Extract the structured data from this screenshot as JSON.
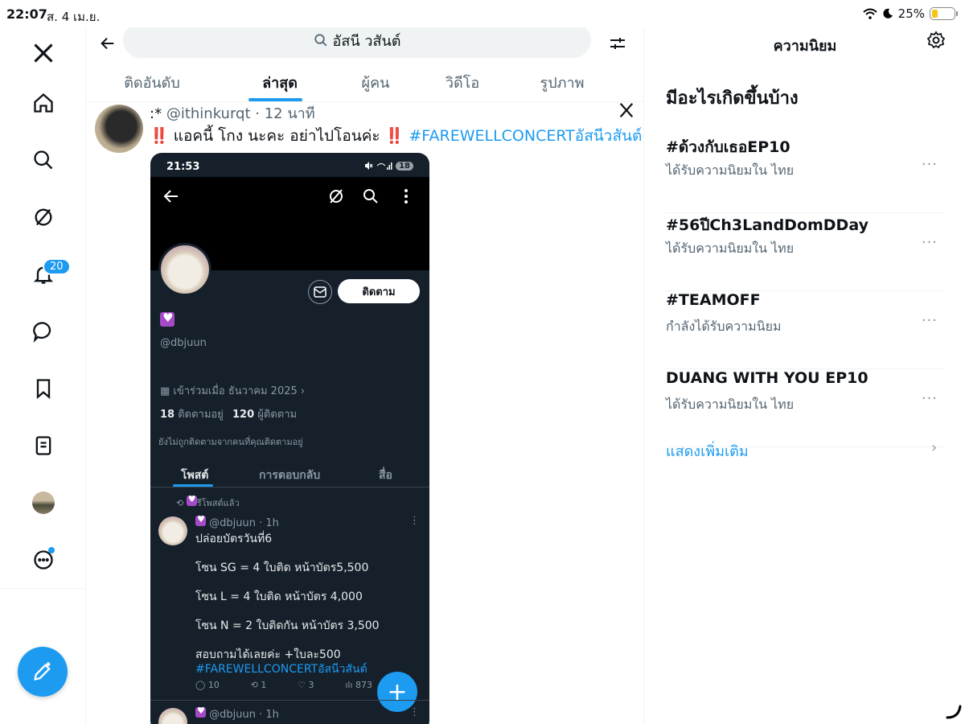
{
  "status_bar": {
    "time": "22:07",
    "date": "ส. 4 เม.ย.",
    "battery": "25%",
    "battery_level": 0.25
  },
  "rail": {
    "items": [
      "x-logo",
      "home",
      "search",
      "grok",
      "notifications",
      "messages",
      "bookmarks",
      "lists",
      "profile",
      "more"
    ],
    "notifications_badge": "20"
  },
  "search": {
    "query": "อัสนี วสันต์"
  },
  "tabs": [
    {
      "label": "ติดอันดับ",
      "active": false
    },
    {
      "label": "ล่าสุด",
      "active": true
    },
    {
      "label": "ผู้คน",
      "active": false
    },
    {
      "label": "วิดีโอ",
      "active": false
    },
    {
      "label": "รูปภาพ",
      "active": false
    }
  ],
  "post": {
    "handle_prefix": ":*",
    "handle": "@ithinkurqt",
    "time": "· 12 นาที",
    "bang": "‼️",
    "text_main": " แอคนี้ โกง นะคะ อย่าไปโอนค่ะ ",
    "hashtag": "#FAREWELLCONCERTอัสนีวสันต์"
  },
  "phone": {
    "time": "21:53",
    "notif_count": "18",
    "follow_label": "ติดตาม",
    "username": "@dbjuun",
    "joined": "เข้าร่วมเมื่อ ธันวาคม 2025",
    "following_count": "18",
    "following_label": "ติดตามอยู่",
    "followers_count": "120",
    "followers_label": "ผู้ติดตาม",
    "not_followed": "ยังไม่ถูกติดตามจากคนที่คุณติดตามอยู่",
    "tabs": [
      "โพสต์",
      "การตอบกลับ",
      "สื่อ"
    ],
    "reposted_label": "รีโพสต์แล้ว",
    "tweet": {
      "handle": "@dbjuun · 1h",
      "lines": [
        "ปล่อยบัตรวันที่6",
        "โซน SG = 4 ใบติด หน้าบัตร5,500",
        "โซน L = 4 ใบติด หน้าบัตร 4,000",
        "โซน N = 2 ใบติดกัน หน้าบัตร 3,500",
        "สอบถามได้เลยค่ะ +ใบละ500"
      ],
      "hashtag": "#FAREWELLCONCERTอัสนีวสันต์",
      "replies": "10",
      "reposts": "1",
      "likes": "3",
      "views": "873"
    },
    "tweet2_handle": "@dbjuun · 1h"
  },
  "right": {
    "title": "ความนิยม",
    "heading": "มีอะไรเกิดขึ้นบ้าง",
    "trends": [
      {
        "name": "#ด้วงกับเธอEP10",
        "meta": "ได้รับความนิยมใน ไทย"
      },
      {
        "name": "#56ปีCh3LandDomDDay",
        "meta": "ได้รับความนิยมใน ไทย"
      },
      {
        "name": "#TEAMOFF",
        "meta": "กำลังได้รับความนิยม"
      },
      {
        "name": "DUANG WITH YOU EP10",
        "meta": "ได้รับความนิยมใน ไทย"
      }
    ],
    "show_more": "แสดงเพิ่มเติม",
    "more_glyph": "···",
    "chevron": "›"
  },
  "colors": {
    "accent": "#1d9bf0",
    "dark_bg": "#15202b",
    "alert": "#e0245e"
  }
}
